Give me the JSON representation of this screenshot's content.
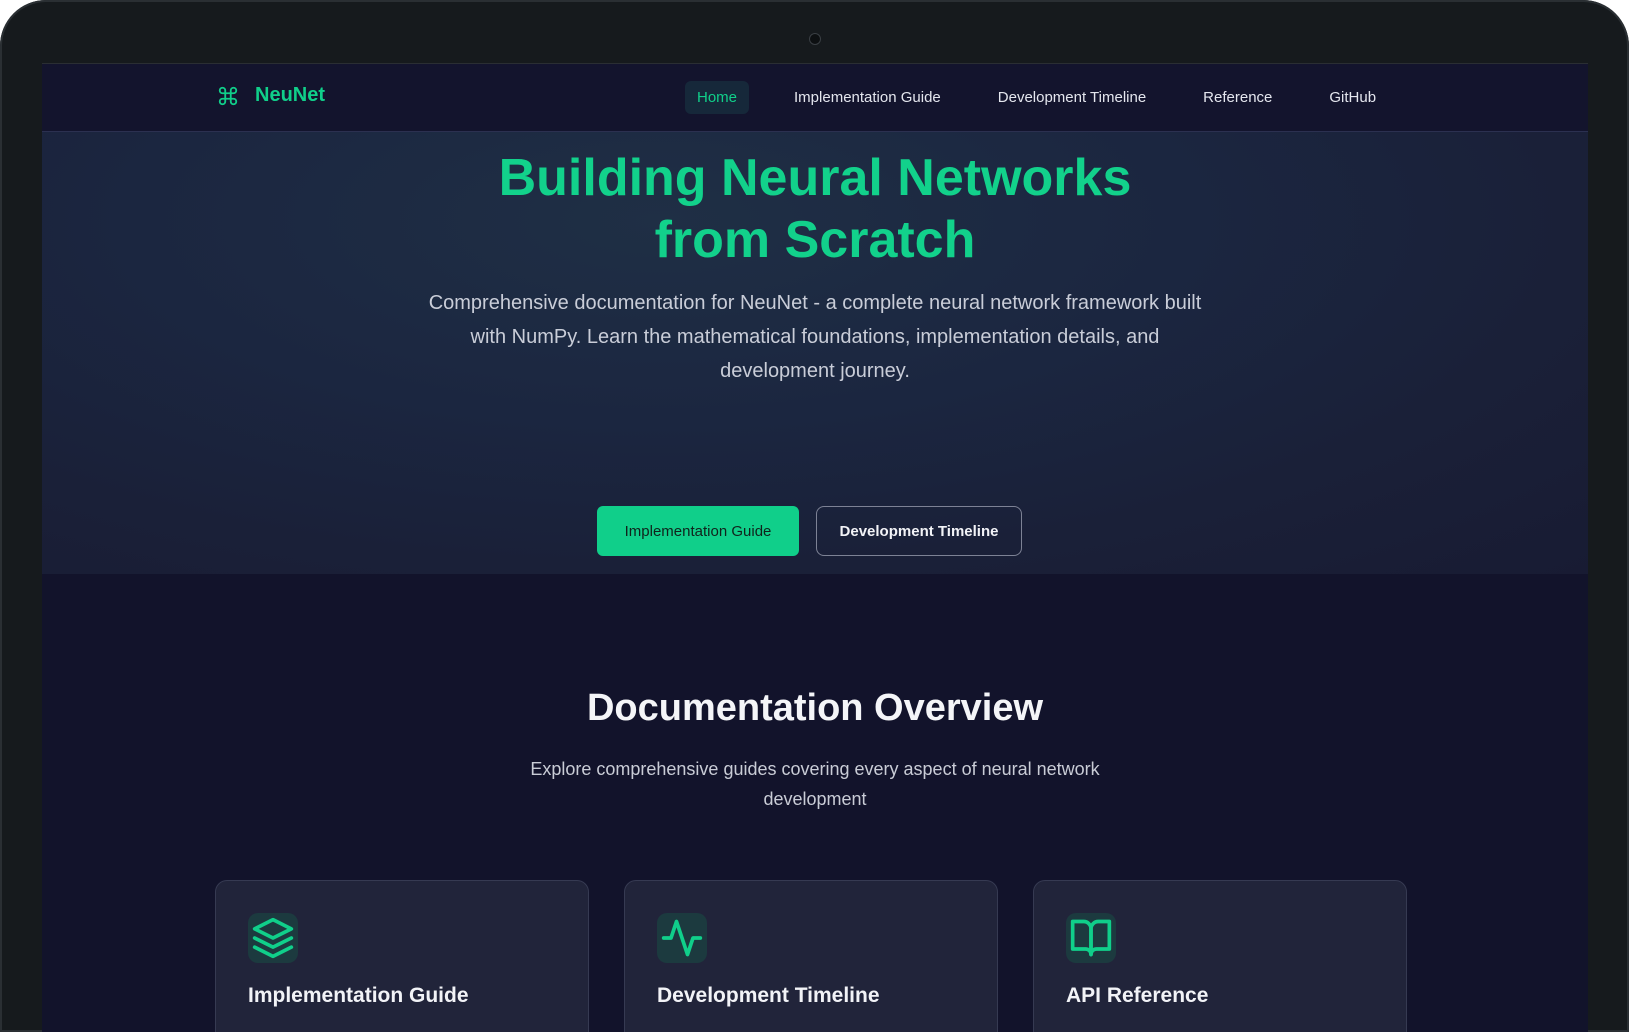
{
  "brand": {
    "name": "NeuNet",
    "icon": "command-icon"
  },
  "nav": {
    "items": [
      {
        "label": "Home",
        "active": true
      },
      {
        "label": "Implementation Guide",
        "active": false
      },
      {
        "label": "Development Timeline",
        "active": false
      },
      {
        "label": "Reference",
        "active": false
      },
      {
        "label": "GitHub",
        "active": false
      }
    ]
  },
  "hero": {
    "title_line1": "Building Neural Networks",
    "title_line2": "from Scratch",
    "description": "Comprehensive documentation for NeuNet - a complete neural network framework built with NumPy. Learn the mathematical foundations, implementation details, and development journey.",
    "primary_button": "Implementation Guide",
    "secondary_button": "Development Timeline"
  },
  "overview": {
    "title": "Documentation Overview",
    "description": "Explore comprehensive guides covering every aspect of neural network development",
    "cards": [
      {
        "title": "Implementation Guide",
        "icon": "layers-icon"
      },
      {
        "title": "Development Timeline",
        "icon": "activity-icon"
      },
      {
        "title": "API Reference",
        "icon": "book-open-icon"
      }
    ]
  },
  "colors": {
    "accent": "#10cf8a",
    "background": "#12132b",
    "card": "#21243a"
  }
}
